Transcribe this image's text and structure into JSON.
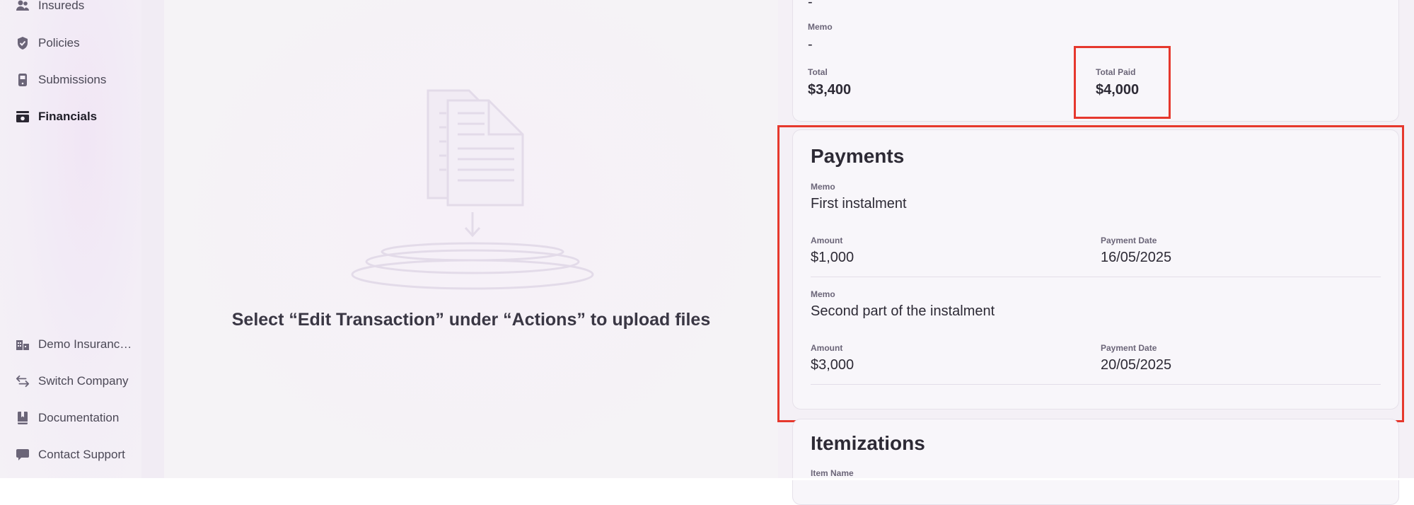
{
  "sidebar": {
    "top_items": [
      {
        "label": "Insureds",
        "icon": "users-icon"
      },
      {
        "label": "Policies",
        "icon": "shield-icon"
      },
      {
        "label": "Submissions",
        "icon": "phone-icon"
      },
      {
        "label": "Financials",
        "icon": "cash-icon",
        "active": true
      }
    ],
    "bottom_items": [
      {
        "label": "Demo Insuranc…",
        "icon": "building-icon"
      },
      {
        "label": "Switch Company",
        "icon": "switch-icon"
      },
      {
        "label": "Documentation",
        "icon": "book-icon"
      },
      {
        "label": "Contact Support",
        "icon": "chat-icon"
      }
    ]
  },
  "upload": {
    "message": "Select “Edit Transaction” under “Actions” to upload files",
    "icon": "document-upload-icon"
  },
  "summary": {
    "top_value": "-",
    "memo_label": "Memo",
    "memo_value": "-",
    "total_label": "Total",
    "total_value": "$3,400",
    "total_paid_label": "Total Paid",
    "total_paid_value": "$4,000"
  },
  "payments": {
    "title": "Payments",
    "items": [
      {
        "memo_label": "Memo",
        "memo": "First instalment",
        "amount_label": "Amount",
        "amount": "$1,000",
        "date_label": "Payment Date",
        "date": "16/05/2025"
      },
      {
        "memo_label": "Memo",
        "memo": "Second part of the instalment",
        "amount_label": "Amount",
        "amount": "$3,000",
        "date_label": "Payment Date",
        "date": "20/05/2025"
      }
    ]
  },
  "itemizations": {
    "title": "Itemizations",
    "item_name_label": "Item Name"
  },
  "colors": {
    "highlight": "#e6382d",
    "text_primary": "#2d2a35",
    "label": "#6b6578"
  }
}
